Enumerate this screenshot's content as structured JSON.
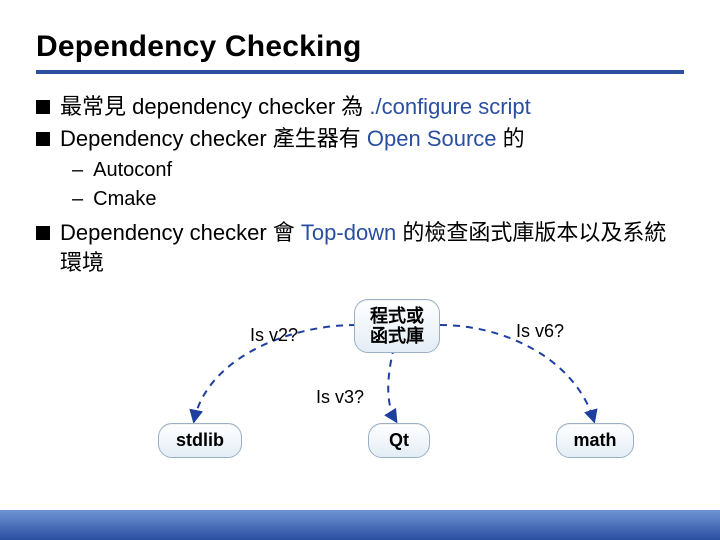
{
  "title": "Dependency Checking",
  "bullets": {
    "b1": {
      "pre": "最常見 dependency checker 為 ",
      "emph": "./configure script"
    },
    "b2": {
      "pre": "Dependency checker 產生器有 ",
      "emph": "Open Source",
      "post": " 的"
    },
    "sub1": "Autoconf",
    "sub2": "Cmake",
    "b3": {
      "pre": "Dependency checker 會 ",
      "emph": "Top-down",
      "post": " 的檢查函式庫版本以及系統環境"
    }
  },
  "diagram": {
    "top": "程式或\n函式庫",
    "left": "stdlib",
    "mid": "Qt",
    "right": "math",
    "labels": {
      "v2": "Is v2?",
      "v3": "Is v3?",
      "v6": "Is v6?"
    }
  }
}
